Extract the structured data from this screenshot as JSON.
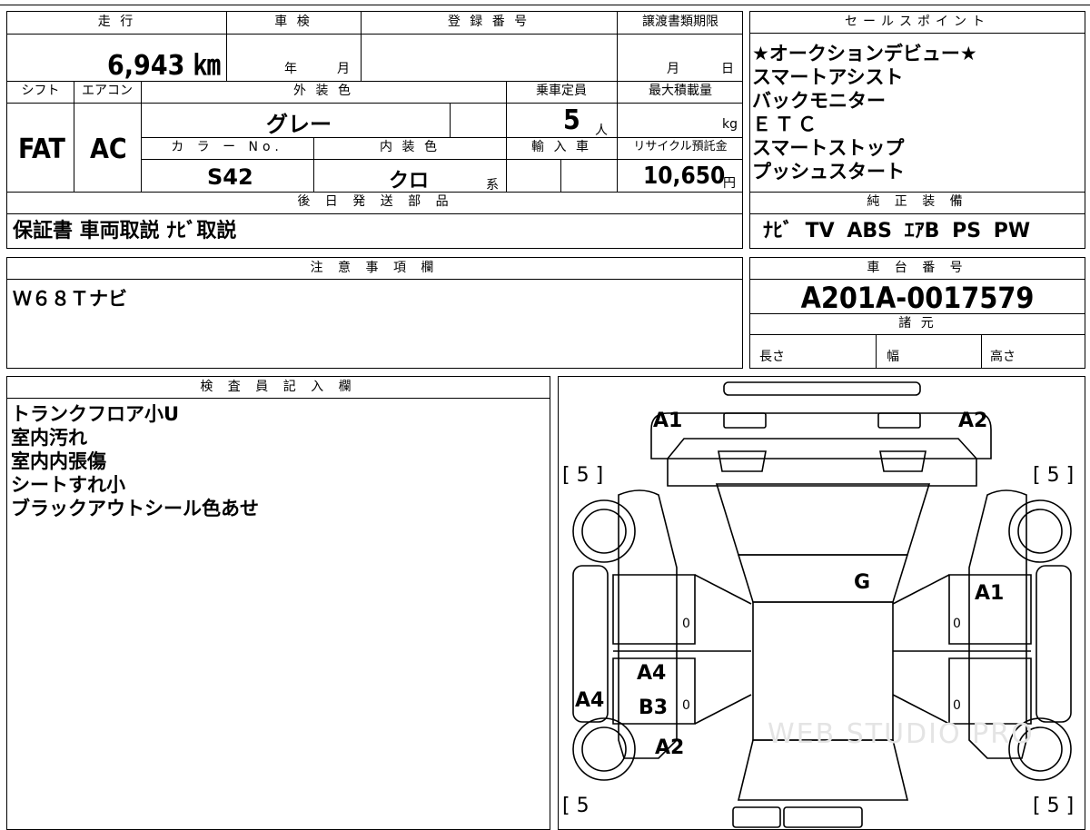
{
  "specs": {
    "mileage_header": "走 行",
    "mileage_value": "6,943 ㎞",
    "shaken_header": "車 検",
    "shaken_year_unit": "年",
    "shaken_month_unit": "月",
    "reg_header": "登 録 番 号",
    "transfer_header": "譲渡書類期限",
    "transfer_month_unit": "月",
    "transfer_day_unit": "日",
    "shift_header": "シフト",
    "shift_value": "FAT",
    "ac_header": "エアコン",
    "ac_value": "AC",
    "exterior_header": "外 装 色",
    "exterior_value": "グレー",
    "capacity_header": "乗車定員",
    "capacity_value": "5",
    "capacity_unit": "人",
    "max_load_header": "最大積載量",
    "max_load_unit": "kg",
    "color_no_header": "カ ラ ー No.",
    "color_no_value": "S42",
    "interior_header": "内 装 色",
    "interior_value": "クロ",
    "interior_unit": "系",
    "import_header": "輸 入 車",
    "recycle_header": "リサイクル預託金",
    "recycle_value": "10,650",
    "recycle_unit": "円"
  },
  "later_parts": {
    "header": "後 日 発 送 部 品",
    "value": "保証書 車両取説 ﾅﾋﾞ取説"
  },
  "sales_points": {
    "header": "セールスポイント",
    "items": [
      "★オークションデビュー★",
      "スマートアシスト",
      "バックモニター",
      "ＥＴＣ",
      "スマートストップ",
      "プッシュスタート"
    ]
  },
  "factory_equipment": {
    "header": "純 正 装 備",
    "value": "ﾅﾋﾞ TV ABS ｴｱB PS PW"
  },
  "notes": {
    "header": "注 意 事 項 欄",
    "value": "Ｗ６８Ｔナビ"
  },
  "chassis": {
    "header": "車 台 番 号",
    "value": "A201A-0017579",
    "specs_header": "諸 元",
    "length_label": "長さ",
    "width_label": "幅",
    "height_label": "高さ"
  },
  "inspector": {
    "header": "検 査 員 記 入 欄",
    "items": [
      "トランクフロア小U",
      "室内汚れ",
      "室内内張傷",
      "シートすれ小",
      "ブラックアウトシール色あせ"
    ]
  },
  "diagram": {
    "marks": [
      "A1",
      "A2",
      "G",
      "A1",
      "A4",
      "A4",
      "B3",
      "A2"
    ],
    "tire_labels": [
      "[ 5 ]",
      "[ 5 ]",
      "[ 5",
      "[ 5 ]"
    ],
    "zero_marks": [
      "0",
      "0",
      "0",
      "0"
    ],
    "watermark": "WEB STUDIO PRO"
  }
}
